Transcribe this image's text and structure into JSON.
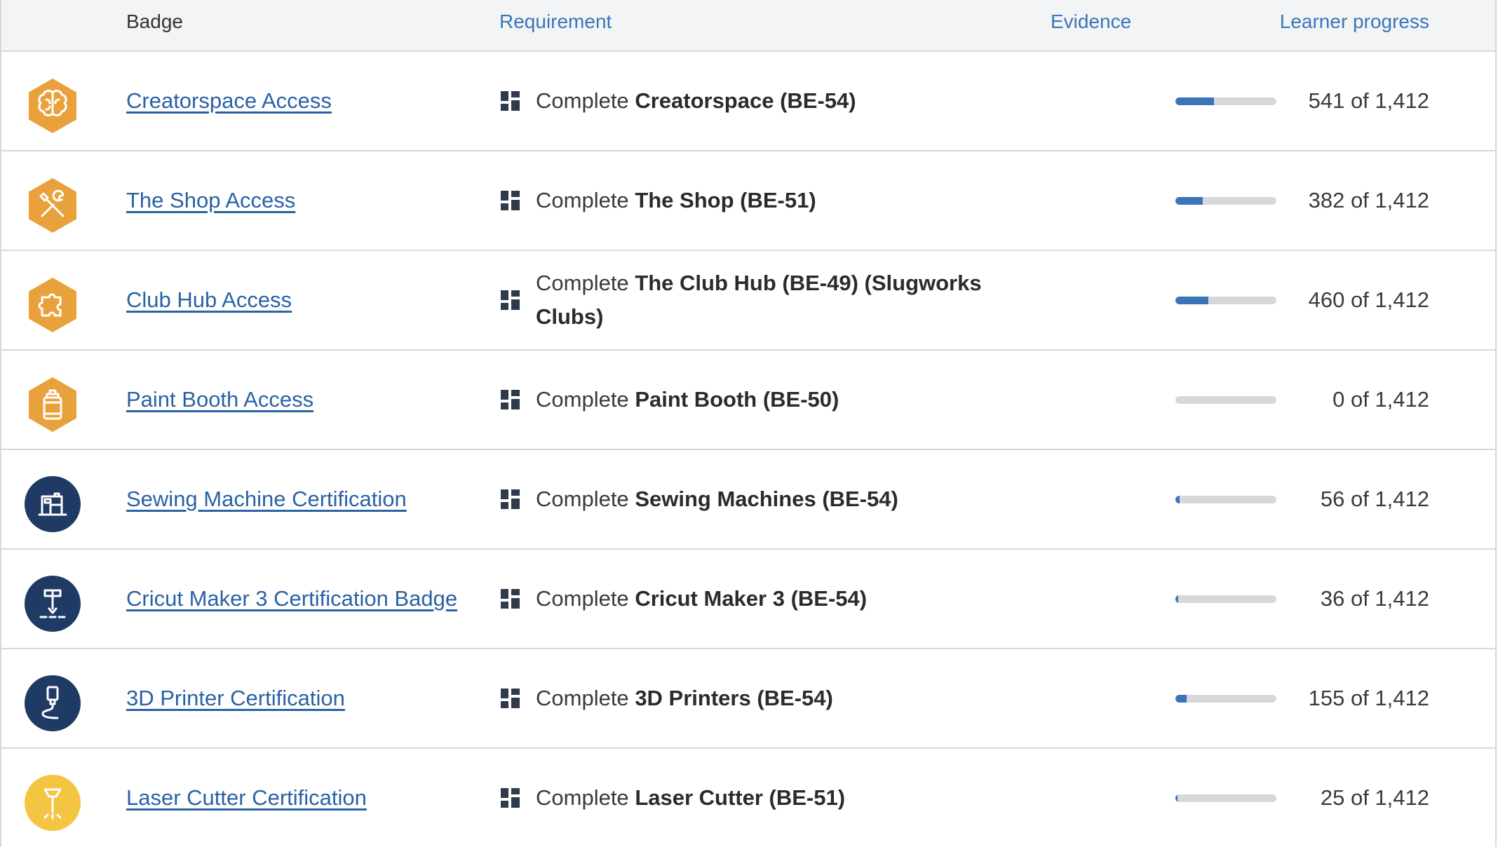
{
  "headers": {
    "badge": "Badge",
    "requirement": "Requirement",
    "evidence": "Evidence",
    "progress": "Learner progress"
  },
  "rows": [
    {
      "name": "Creatorspace Access",
      "icon": "brain-icon",
      "req_prefix": "Complete",
      "req_bold": "Creatorspace (BE-54)",
      "progress_fraction": 0.383,
      "count": "541 of 1,412"
    },
    {
      "name": "The Shop Access",
      "icon": "wrench-screwdriver-icon",
      "req_prefix": "Complete",
      "req_bold": "The Shop (BE-51)",
      "progress_fraction": 0.271,
      "count": "382 of 1,412"
    },
    {
      "name": "Club Hub Access",
      "icon": "puzzle-icon",
      "req_prefix": "Complete",
      "req_bold": "The Club Hub (BE-49) (Slugworks Clubs)",
      "progress_fraction": 0.326,
      "count": "460 of 1,412"
    },
    {
      "name": "Paint Booth Access",
      "icon": "spray-can-icon",
      "req_prefix": "Complete",
      "req_bold": "Paint Booth (BE-50)",
      "progress_fraction": 0.0,
      "count": "0 of 1,412"
    },
    {
      "name": "Sewing Machine Certification",
      "icon": "sewing-machine-icon",
      "req_prefix": "Complete",
      "req_bold": "Sewing Machines (BE-54)",
      "progress_fraction": 0.04,
      "count": "56 of 1,412"
    },
    {
      "name": "Cricut Maker 3 Certification Badge",
      "icon": "cutter-blade-icon",
      "req_prefix": "Complete",
      "req_bold": "Cricut Maker 3 (BE-54)",
      "progress_fraction": 0.025,
      "count": "36 of 1,412"
    },
    {
      "name": "3D Printer Certification",
      "icon": "3d-printer-nozzle-icon",
      "req_prefix": "Complete",
      "req_bold": "3D Printers (BE-54)",
      "progress_fraction": 0.11,
      "count": "155 of 1,412"
    },
    {
      "name": "Laser Cutter Certification",
      "icon": "laser-icon",
      "req_prefix": "Complete",
      "req_bold": "Laser Cutter (BE-51)",
      "progress_fraction": 0.018,
      "count": "25 of 1,412"
    }
  ],
  "colors": {
    "accent": "#3b74b7",
    "link": "#2a62a5",
    "badge_orange": "#e9a23b",
    "badge_navy": "#1f3a64",
    "badge_yellow": "#f4c542"
  }
}
